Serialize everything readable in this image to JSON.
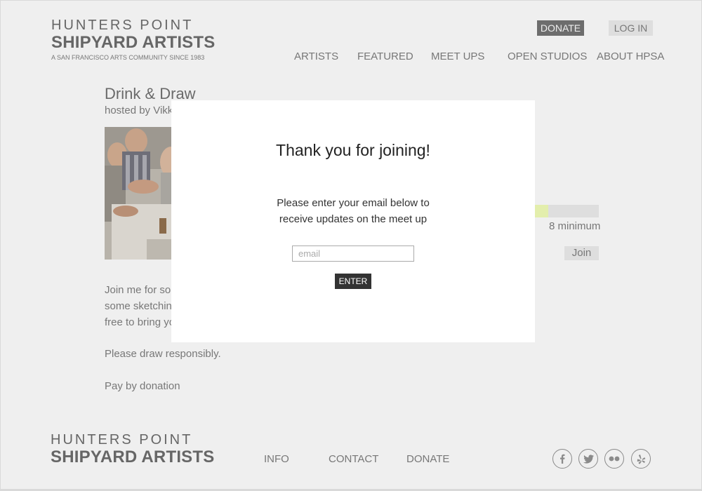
{
  "header": {
    "logo_top": "HUNTERS POINT",
    "logo_bottom": "SHIPYARD ARTISTS",
    "tagline": "A SAN FRANCISCO ARTS COMMUNITY SINCE 1983",
    "donate_label": "DONATE",
    "login_label": "LOG IN",
    "nav": [
      "ARTISTS",
      "FEATURED",
      "MEET UPS",
      "OPEN STUDIOS",
      "ABOUT HPSA"
    ]
  },
  "event": {
    "title": "Drink & Draw",
    "host": "hosted by Vikki",
    "progress_fraction": 0.22,
    "minimum_label": "8 minimum",
    "join_label": "Join",
    "description_lines": [
      "Join me for som",
      "some sketching",
      "free to bring yo"
    ],
    "note": "Please draw responsibly.",
    "payment": "Pay by donation"
  },
  "modal": {
    "title": "Thank you for joining!",
    "message_line1": "Please enter your email below to",
    "message_line2": "receive updates on the meet up",
    "email_placeholder": "email",
    "email_value": "",
    "enter_label": "ENTER"
  },
  "footer": {
    "logo_top": "HUNTERS POINT",
    "logo_bottom": "SHIPYARD ARTISTS",
    "links": [
      "INFO",
      "CONTACT",
      "DONATE"
    ],
    "social_icons": [
      "facebook-icon",
      "twitter-icon",
      "flickr-icon",
      "yelp-icon"
    ]
  },
  "colors": {
    "page_bg": "#efefef",
    "modal_bg": "#ffffff",
    "donate_bg": "#6d6d6d",
    "progress_fill": "#e3eeac",
    "enter_bg": "#333333"
  }
}
